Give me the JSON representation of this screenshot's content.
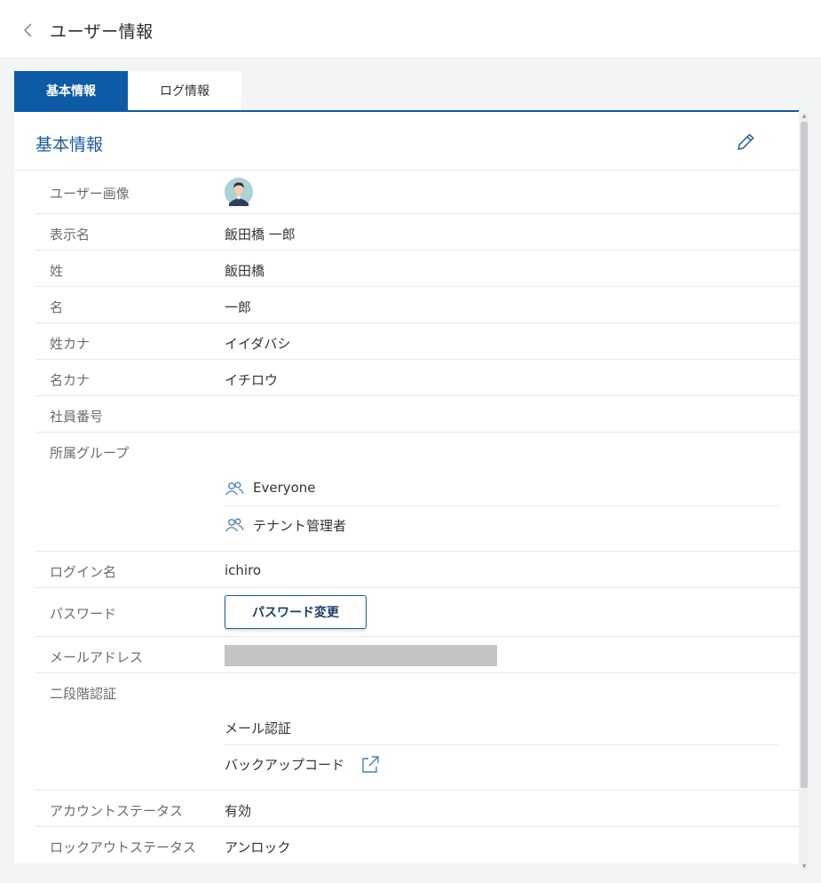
{
  "header": {
    "title": "ユーザー情報"
  },
  "tabs": [
    {
      "label": "基本情報"
    },
    {
      "label": "ログ情報"
    }
  ],
  "section": {
    "title": "基本情報"
  },
  "fields": {
    "user_image": {
      "label": "ユーザー画像"
    },
    "display_name": {
      "label": "表示名",
      "value": "飯田橋 一郎"
    },
    "last_name": {
      "label": "姓",
      "value": "飯田橋"
    },
    "first_name": {
      "label": "名",
      "value": "一郎"
    },
    "last_name_kana": {
      "label": "姓カナ",
      "value": "イイダバシ"
    },
    "first_name_kana": {
      "label": "名カナ",
      "value": "イチロウ"
    },
    "employee_number": {
      "label": "社員番号",
      "value": ""
    },
    "groups": {
      "label": "所属グループ",
      "items": [
        "Everyone",
        "テナント管理者"
      ]
    },
    "login_name": {
      "label": "ログイン名",
      "value": "ichiro"
    },
    "password": {
      "label": "パスワード",
      "button_label": "パスワード変更"
    },
    "email": {
      "label": "メールアドレス"
    },
    "two_factor": {
      "label": "二段階認証",
      "items": [
        "メール認証",
        "バックアップコード"
      ]
    },
    "account_status": {
      "label": "アカウントステータス",
      "value": "有効"
    },
    "lockout_status": {
      "label": "ロックアウトステータス",
      "value": "アンロック"
    }
  },
  "colors": {
    "accent": "#0d5aa7",
    "title_blue": "#1a5c9e",
    "icon_blue": "#4a7fb5"
  },
  "icons": [
    "chevron-left-icon",
    "pencil-icon",
    "group-icon",
    "external-link-icon"
  ]
}
